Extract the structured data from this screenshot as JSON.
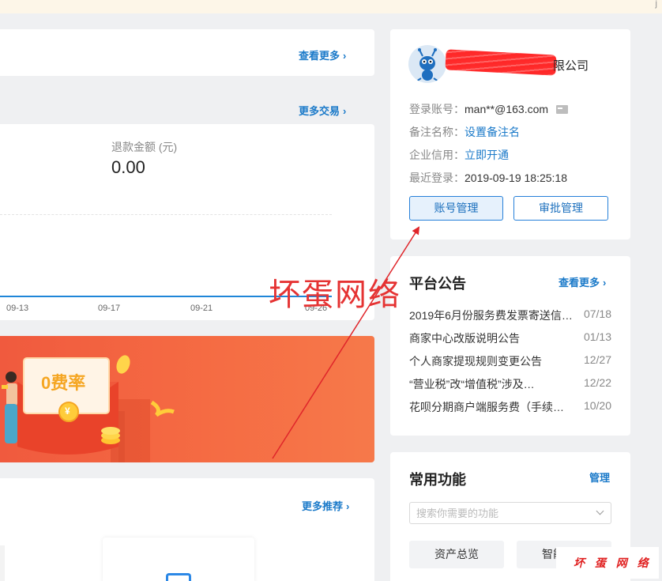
{
  "topbar": {
    "end_glyph": "j"
  },
  "top_card": {
    "more_label": "查看更多"
  },
  "trade": {
    "more_label": "更多交易",
    "refund_label": "退款金额 (元)",
    "refund_value": "0.00",
    "x_ticks": [
      "09-13",
      "09-17",
      "09-21",
      "09-26"
    ]
  },
  "banner": {
    "rate_text": "0费率",
    "coin_symbol": "¥"
  },
  "recommend": {
    "more_label": "更多推荐"
  },
  "account": {
    "company_suffix": "限公司",
    "login_label": "登录账号：",
    "login_value": "man**@163.com",
    "remark_label": "备注名称：",
    "remark_link": "设置备注名",
    "credit_label": "企业信用：",
    "credit_link": "立即开通",
    "last_login_label": "最近登录：",
    "last_login_value": "2019-09-19 18:25:18",
    "btn_account": "账号管理",
    "btn_approve": "审批管理"
  },
  "notice": {
    "title": "平台公告",
    "more_label": "查看更多",
    "items": [
      {
        "text": "2019年6月份服务费发票寄送信…",
        "date": "07/18"
      },
      {
        "text": "商家中心改版说明公告",
        "date": "01/13"
      },
      {
        "text": "个人商家提现规则变更公告",
        "date": "12/27"
      },
      {
        "text": "“营业税”改“增值税”涉及…",
        "date": "12/22"
      },
      {
        "text": "花呗分期商户端服务费（手续…",
        "date": "10/20"
      }
    ]
  },
  "functions": {
    "title": "常用功能",
    "manage_label": "管理",
    "search_placeholder": "搜索你需要的功能",
    "items": [
      "资产总览",
      "智能"
    ]
  },
  "watermarks": {
    "big": "坏蛋网络",
    "small": "坏 蛋 网 络"
  },
  "colors": {
    "accent": "#1b7ac9",
    "banner": "#f05a3e",
    "annotation": "#e53333"
  }
}
